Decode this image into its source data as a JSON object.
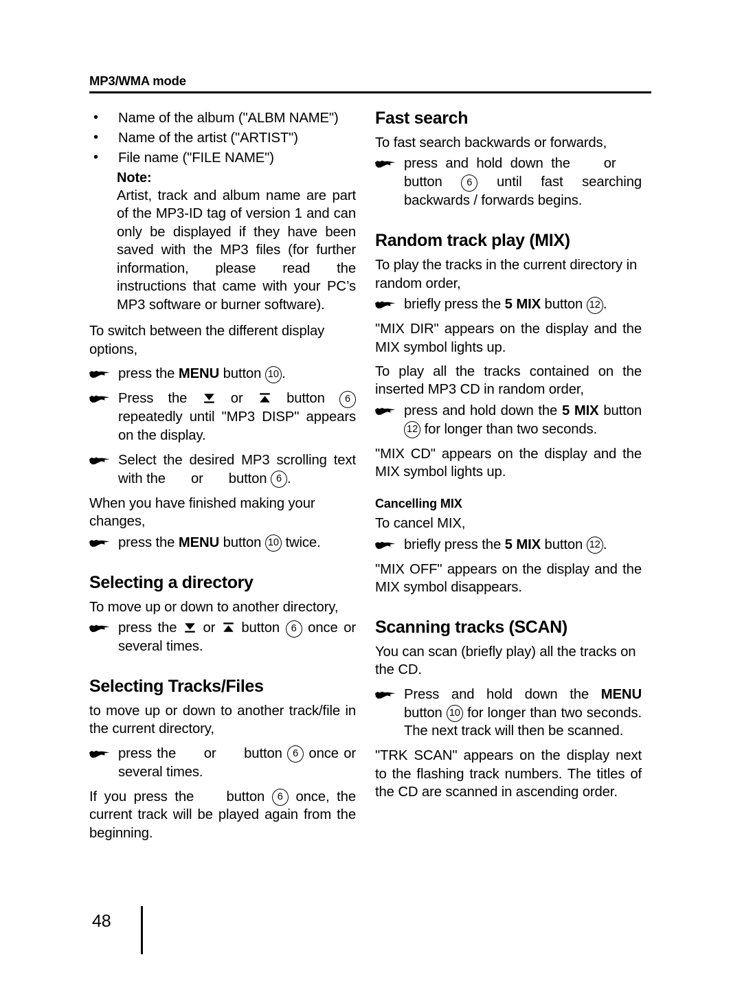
{
  "header": {
    "title": "MP3/WMA mode"
  },
  "footer": {
    "page_number": "48"
  },
  "left_column": {
    "bullets": [
      "Name of the album (\"ALBM NAME\")",
      "Name of the artist (\"ARTIST\")",
      "File name (\"FILE NAME\")"
    ],
    "note": {
      "label": "Note:",
      "body": "Artist, track and album name are part of the MP3-ID tag of version 1 and can only be displayed if they have been saved with the MP3 files (for further information, please read the instructions that came with your PC’s MP3 software or burner software)."
    },
    "display_options": {
      "intro": "To switch between the different display options,",
      "step1_pre": "press the ",
      "step1_bold": "MENU",
      "step1_mid": " button ",
      "step1_num": "10",
      "step1_post": ".",
      "step2_pre": "Press the ",
      "step2_or": " or ",
      "step2_mid": " button ",
      "step2_num": "6",
      "step2_post": " repeatedly until \"MP3 DISP\" appears on the display.",
      "step3_pre": "Select the desired MP3 scrolling text with the ",
      "step3_or": " or ",
      "step3_mid": " button ",
      "step3_num": "6",
      "step3_post": ".",
      "outro": "When you have finished making your changes,",
      "step4_pre": "press the ",
      "step4_bold": "MENU",
      "step4_mid": " button ",
      "step4_num": "10",
      "step4_post": " twice."
    },
    "selecting_directory": {
      "heading": "Selecting a directory",
      "intro": "To move up or down to another directory,",
      "step_pre": "press the ",
      "step_or": " or ",
      "step_mid": " button ",
      "step_num": "6",
      "step_post": " once or several times."
    },
    "selecting_tracks": {
      "heading": "Selecting Tracks/Files",
      "intro": "to move up or down to another track/file in the current directory,",
      "step_pre": "press the ",
      "step_or": " or ",
      "step_mid": " button ",
      "step_num": "6",
      "step_post": " once or several times.",
      "outro_pre": "If you press the ",
      "outro_mid": " button ",
      "outro_num": "6",
      "outro_post": " once, the current track will be played again from the beginning."
    }
  },
  "right_column": {
    "fast_search": {
      "heading": "Fast search",
      "intro": "To fast search backwards or forwards,",
      "step_pre": "press and hold down the ",
      "step_or": " or ",
      "step_mid": " button ",
      "step_num": "6",
      "step_post": " until fast searching backwards / forwards begins."
    },
    "random_track_play": {
      "heading": "Random track play (MIX)",
      "intro1": "To play the tracks in the current directory in random order,",
      "step1_pre": "briefly press the ",
      "step1_bold": "5 MIX",
      "step1_mid": " button ",
      "step1_num": "12",
      "step1_post": ".",
      "result1": "\"MIX DIR\" appears on the display and the MIX symbol lights up.",
      "intro2": "To play all the tracks contained on the inserted MP3 CD in random order,",
      "step2_pre": "press and hold down the ",
      "step2_bold": "5 MIX",
      "step2_mid": " button ",
      "step2_num": "12",
      "step2_post": " for longer than two seconds.",
      "result2": "\"MIX CD\" appears on the display and the MIX symbol lights up."
    },
    "cancelling_mix": {
      "heading": "Cancelling MIX",
      "intro": "To cancel MIX,",
      "step_pre": "briefly press the ",
      "step_bold": "5 MIX",
      "step_mid": " button ",
      "step_num": "12",
      "step_post": ".",
      "result": "\"MIX OFF\" appears on the display and the MIX symbol disappears."
    },
    "scanning_tracks": {
      "heading": "Scanning tracks (SCAN)",
      "intro": "You can scan (briefly play) all the tracks on the CD.",
      "step_pre": "Press and hold down the ",
      "step_bold": "MENU",
      "step_mid": " button ",
      "step_num": "10",
      "step_post": " for longer than two seconds. The next track will then be scanned.",
      "result": "\"TRK SCAN\" appears on the display next to the flashing track numbers. The titles of the CD are scanned in ascending order."
    }
  }
}
